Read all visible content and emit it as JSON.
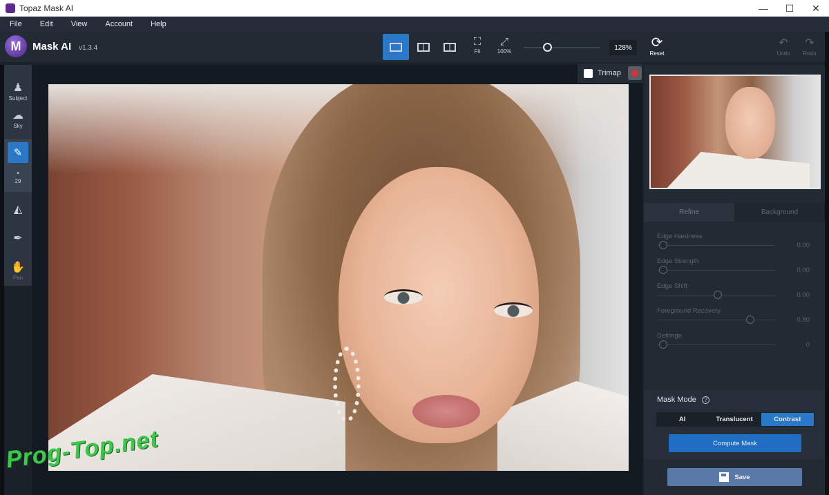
{
  "window": {
    "title": "Topaz Mask AI",
    "minimize": "—",
    "maximize": "☐",
    "close": "✕"
  },
  "menu": [
    "File",
    "Edit",
    "View",
    "Account",
    "Help"
  ],
  "app": {
    "logo_letter": "M",
    "name": "Mask AI",
    "version": "v1.3.4"
  },
  "toolbar": {
    "fit_label": "Fit",
    "full_label": "100%",
    "zoom_value": "128%",
    "zoom_level_fraction": 0.25,
    "reset_label": "Reset",
    "undo_label": "Undo",
    "redo_label": "Redo"
  },
  "left_tools": {
    "subject": "Subject",
    "sky": "Sky",
    "brush_size": "29",
    "pan": "Pan"
  },
  "trimap": {
    "label": "Trimap"
  },
  "tabs": {
    "refine": "Refine",
    "background": "Background"
  },
  "sliders": [
    {
      "label": "Edge Hardness",
      "value": "0.00",
      "level": 0.0
    },
    {
      "label": "Edge Strength",
      "value": "0.00",
      "level": 0.0
    },
    {
      "label": "Edge Shift",
      "value": "0.00",
      "level": 0.5
    },
    {
      "label": "Foreground Recovery",
      "value": "0.80",
      "level": 0.8
    },
    {
      "label": "Defringe",
      "value": "0",
      "level": 0.0
    }
  ],
  "mask_mode": {
    "title": "Mask Mode",
    "help": "?",
    "options": [
      "AI",
      "Translucent",
      "Contrast"
    ],
    "selected": "Contrast"
  },
  "buttons": {
    "compute": "Compute Mask",
    "save": "Save"
  },
  "watermark": "Prog-Top.net",
  "colors": {
    "accent": "#2a78c8",
    "save": "#5b79a6",
    "panel": "#222a34"
  }
}
